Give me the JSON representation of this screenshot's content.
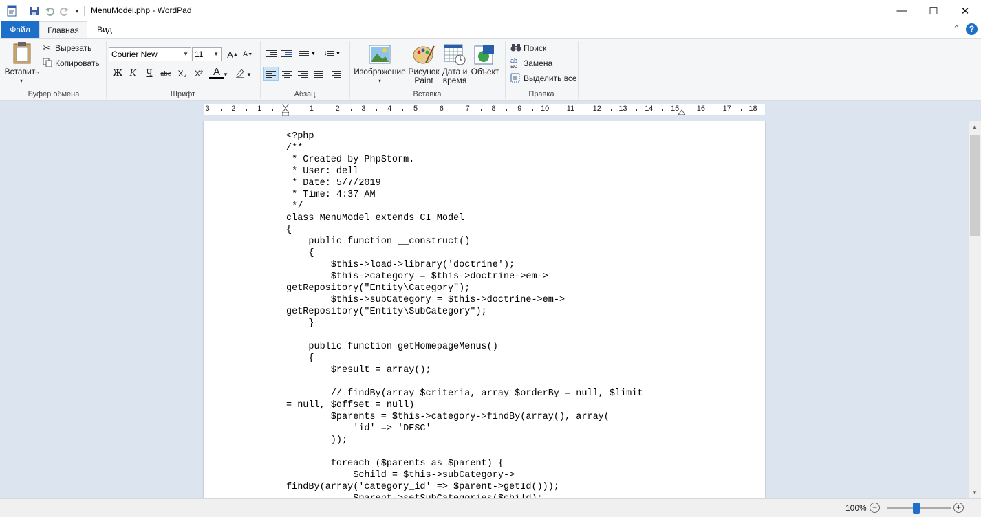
{
  "window": {
    "title": "MenuModel.php - WordPad",
    "minimize_glyph": "—",
    "maximize_glyph": "☐",
    "close_glyph": "✕"
  },
  "ribbon": {
    "tabs": [
      {
        "label": "Файл"
      },
      {
        "label": "Главная"
      },
      {
        "label": "Вид"
      }
    ],
    "clipboard": {
      "paste_label": "Вставить",
      "cut_label": "Вырезать",
      "copy_label": "Копировать",
      "group_label": "Буфер обмена"
    },
    "font": {
      "family_value": "Courier New",
      "size_value": "11",
      "bold": "Ж",
      "italic": "К",
      "underline": "Ч",
      "strike": "abc",
      "subscript": "X₂",
      "superscript": "X²",
      "font_color_letter": "A",
      "group_label": "Шрифт"
    },
    "paragraph": {
      "group_label": "Абзац"
    },
    "insert": {
      "image_label": "Изображение",
      "paint_label_1": "Рисунок",
      "paint_label_2": "Paint",
      "datetime_label_1": "Дата и",
      "datetime_label_2": "время",
      "object_label": "Объект",
      "group_label": "Вставка"
    },
    "editing": {
      "find_label": "Поиск",
      "replace_label": "Замена",
      "select_all_label": "Выделить все",
      "group_label": "Правка"
    },
    "help_glyph": "?"
  },
  "ruler": {
    "ticks": [
      "3",
      "2",
      "1",
      "1",
      "2",
      "3",
      "4",
      "5",
      "6",
      "7",
      "8",
      "9",
      "10",
      "11",
      "12",
      "13",
      "14",
      "15",
      "16",
      "17",
      "18"
    ]
  },
  "document": {
    "content": "<?php\n/**\n * Created by PhpStorm.\n * User: dell\n * Date: 5/7/2019\n * Time: 4:37 AM\n */\nclass MenuModel extends CI_Model\n{\n    public function __construct()\n    {\n        $this->load->library('doctrine');\n        $this->category = $this->doctrine->em->\ngetRepository(\"Entity\\Category\");\n        $this->subCategory = $this->doctrine->em->\ngetRepository(\"Entity\\SubCategory\");\n    }\n\n    public function getHomepageMenus()\n    {\n        $result = array();\n\n        // findBy(array $criteria, array $orderBy = null, $limit\n= null, $offset = null)\n        $parents = $this->category->findBy(array(), array(\n            'id' => 'DESC'\n        ));\n\n        foreach ($parents as $parent) {\n            $child = $this->subCategory->\nfindBy(array('category_id' => $parent->getId()));\n            $parent->setSubCategories($child);"
  },
  "status": {
    "zoom": "100%",
    "zoom_out": "−",
    "zoom_in": "+"
  }
}
